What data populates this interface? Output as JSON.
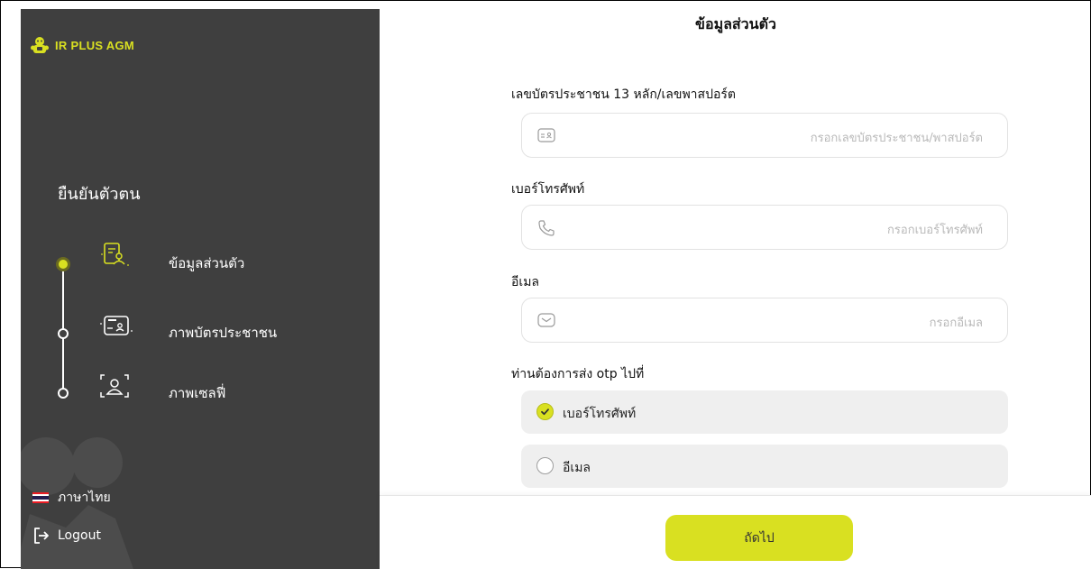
{
  "sidebar": {
    "logo_text": "IR PLUS AGM",
    "heading": "ยืนยันตัวตน",
    "steps": [
      {
        "label": "ข้อมูลส่วนตัว",
        "active": true,
        "icon": "personal-info-icon"
      },
      {
        "label": "ภาพบัตรประชาชน",
        "active": false,
        "icon": "id-card-icon"
      },
      {
        "label": "ภาพเซลฟี่",
        "active": false,
        "icon": "selfie-icon"
      }
    ],
    "language": "ภาษาไทย",
    "logout": "Logout"
  },
  "main": {
    "title": "ข้อมูลส่วนตัว",
    "id_label": "เลขบัตรประชาชน 13 หลัก/เลขพาสปอร์ต",
    "id_placeholder": "กรอกเลขบัตรประชาชน/พาสปอร์ต",
    "phone_label": "เบอร์โทรศัพท์",
    "phone_placeholder": "กรอกเบอร์โทรศัพท์",
    "email_label": "อีเมล",
    "email_placeholder": "กรอกอีเมล",
    "otp_label": "ท่านต้องการส่ง otp ไปที่",
    "otp_options": [
      {
        "label": "เบอร์โทรศัพท์",
        "selected": true
      },
      {
        "label": "อีเมล",
        "selected": false
      }
    ],
    "next_button": "ถัดไป"
  },
  "colors": {
    "accent": "#d9e021",
    "sidebar_bg": "#3f3f3f",
    "flag_red": "#ed1c24",
    "flag_white": "#ffffff",
    "flag_blue": "#241d4f"
  }
}
